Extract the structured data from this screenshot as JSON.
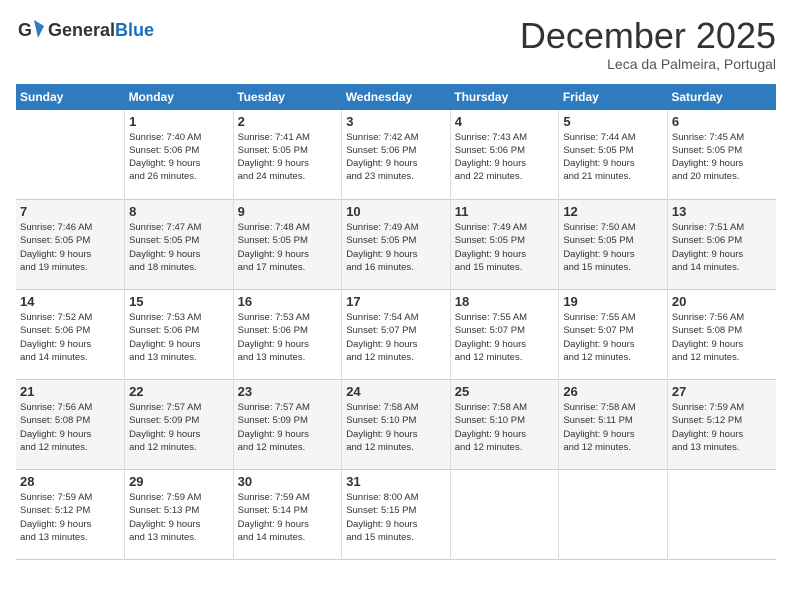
{
  "logo": {
    "general": "General",
    "blue": "Blue"
  },
  "header": {
    "month": "December 2025",
    "location": "Leca da Palmeira, Portugal"
  },
  "weekdays": [
    "Sunday",
    "Monday",
    "Tuesday",
    "Wednesday",
    "Thursday",
    "Friday",
    "Saturday"
  ],
  "weeks": [
    [
      {
        "day": "",
        "info": ""
      },
      {
        "day": "1",
        "info": "Sunrise: 7:40 AM\nSunset: 5:06 PM\nDaylight: 9 hours\nand 26 minutes."
      },
      {
        "day": "2",
        "info": "Sunrise: 7:41 AM\nSunset: 5:05 PM\nDaylight: 9 hours\nand 24 minutes."
      },
      {
        "day": "3",
        "info": "Sunrise: 7:42 AM\nSunset: 5:06 PM\nDaylight: 9 hours\nand 23 minutes."
      },
      {
        "day": "4",
        "info": "Sunrise: 7:43 AM\nSunset: 5:06 PM\nDaylight: 9 hours\nand 22 minutes."
      },
      {
        "day": "5",
        "info": "Sunrise: 7:44 AM\nSunset: 5:05 PM\nDaylight: 9 hours\nand 21 minutes."
      },
      {
        "day": "6",
        "info": "Sunrise: 7:45 AM\nSunset: 5:05 PM\nDaylight: 9 hours\nand 20 minutes."
      }
    ],
    [
      {
        "day": "7",
        "info": "Sunrise: 7:46 AM\nSunset: 5:05 PM\nDaylight: 9 hours\nand 19 minutes."
      },
      {
        "day": "8",
        "info": "Sunrise: 7:47 AM\nSunset: 5:05 PM\nDaylight: 9 hours\nand 18 minutes."
      },
      {
        "day": "9",
        "info": "Sunrise: 7:48 AM\nSunset: 5:05 PM\nDaylight: 9 hours\nand 17 minutes."
      },
      {
        "day": "10",
        "info": "Sunrise: 7:49 AM\nSunset: 5:05 PM\nDaylight: 9 hours\nand 16 minutes."
      },
      {
        "day": "11",
        "info": "Sunrise: 7:49 AM\nSunset: 5:05 PM\nDaylight: 9 hours\nand 15 minutes."
      },
      {
        "day": "12",
        "info": "Sunrise: 7:50 AM\nSunset: 5:05 PM\nDaylight: 9 hours\nand 15 minutes."
      },
      {
        "day": "13",
        "info": "Sunrise: 7:51 AM\nSunset: 5:06 PM\nDaylight: 9 hours\nand 14 minutes."
      }
    ],
    [
      {
        "day": "14",
        "info": "Sunrise: 7:52 AM\nSunset: 5:06 PM\nDaylight: 9 hours\nand 14 minutes."
      },
      {
        "day": "15",
        "info": "Sunrise: 7:53 AM\nSunset: 5:06 PM\nDaylight: 9 hours\nand 13 minutes."
      },
      {
        "day": "16",
        "info": "Sunrise: 7:53 AM\nSunset: 5:06 PM\nDaylight: 9 hours\nand 13 minutes."
      },
      {
        "day": "17",
        "info": "Sunrise: 7:54 AM\nSunset: 5:07 PM\nDaylight: 9 hours\nand 12 minutes."
      },
      {
        "day": "18",
        "info": "Sunrise: 7:55 AM\nSunset: 5:07 PM\nDaylight: 9 hours\nand 12 minutes."
      },
      {
        "day": "19",
        "info": "Sunrise: 7:55 AM\nSunset: 5:07 PM\nDaylight: 9 hours\nand 12 minutes."
      },
      {
        "day": "20",
        "info": "Sunrise: 7:56 AM\nSunset: 5:08 PM\nDaylight: 9 hours\nand 12 minutes."
      }
    ],
    [
      {
        "day": "21",
        "info": "Sunrise: 7:56 AM\nSunset: 5:08 PM\nDaylight: 9 hours\nand 12 minutes."
      },
      {
        "day": "22",
        "info": "Sunrise: 7:57 AM\nSunset: 5:09 PM\nDaylight: 9 hours\nand 12 minutes."
      },
      {
        "day": "23",
        "info": "Sunrise: 7:57 AM\nSunset: 5:09 PM\nDaylight: 9 hours\nand 12 minutes."
      },
      {
        "day": "24",
        "info": "Sunrise: 7:58 AM\nSunset: 5:10 PM\nDaylight: 9 hours\nand 12 minutes."
      },
      {
        "day": "25",
        "info": "Sunrise: 7:58 AM\nSunset: 5:10 PM\nDaylight: 9 hours\nand 12 minutes."
      },
      {
        "day": "26",
        "info": "Sunrise: 7:58 AM\nSunset: 5:11 PM\nDaylight: 9 hours\nand 12 minutes."
      },
      {
        "day": "27",
        "info": "Sunrise: 7:59 AM\nSunset: 5:12 PM\nDaylight: 9 hours\nand 13 minutes."
      }
    ],
    [
      {
        "day": "28",
        "info": "Sunrise: 7:59 AM\nSunset: 5:12 PM\nDaylight: 9 hours\nand 13 minutes."
      },
      {
        "day": "29",
        "info": "Sunrise: 7:59 AM\nSunset: 5:13 PM\nDaylight: 9 hours\nand 13 minutes."
      },
      {
        "day": "30",
        "info": "Sunrise: 7:59 AM\nSunset: 5:14 PM\nDaylight: 9 hours\nand 14 minutes."
      },
      {
        "day": "31",
        "info": "Sunrise: 8:00 AM\nSunset: 5:15 PM\nDaylight: 9 hours\nand 15 minutes."
      },
      {
        "day": "",
        "info": ""
      },
      {
        "day": "",
        "info": ""
      },
      {
        "day": "",
        "info": ""
      }
    ]
  ]
}
